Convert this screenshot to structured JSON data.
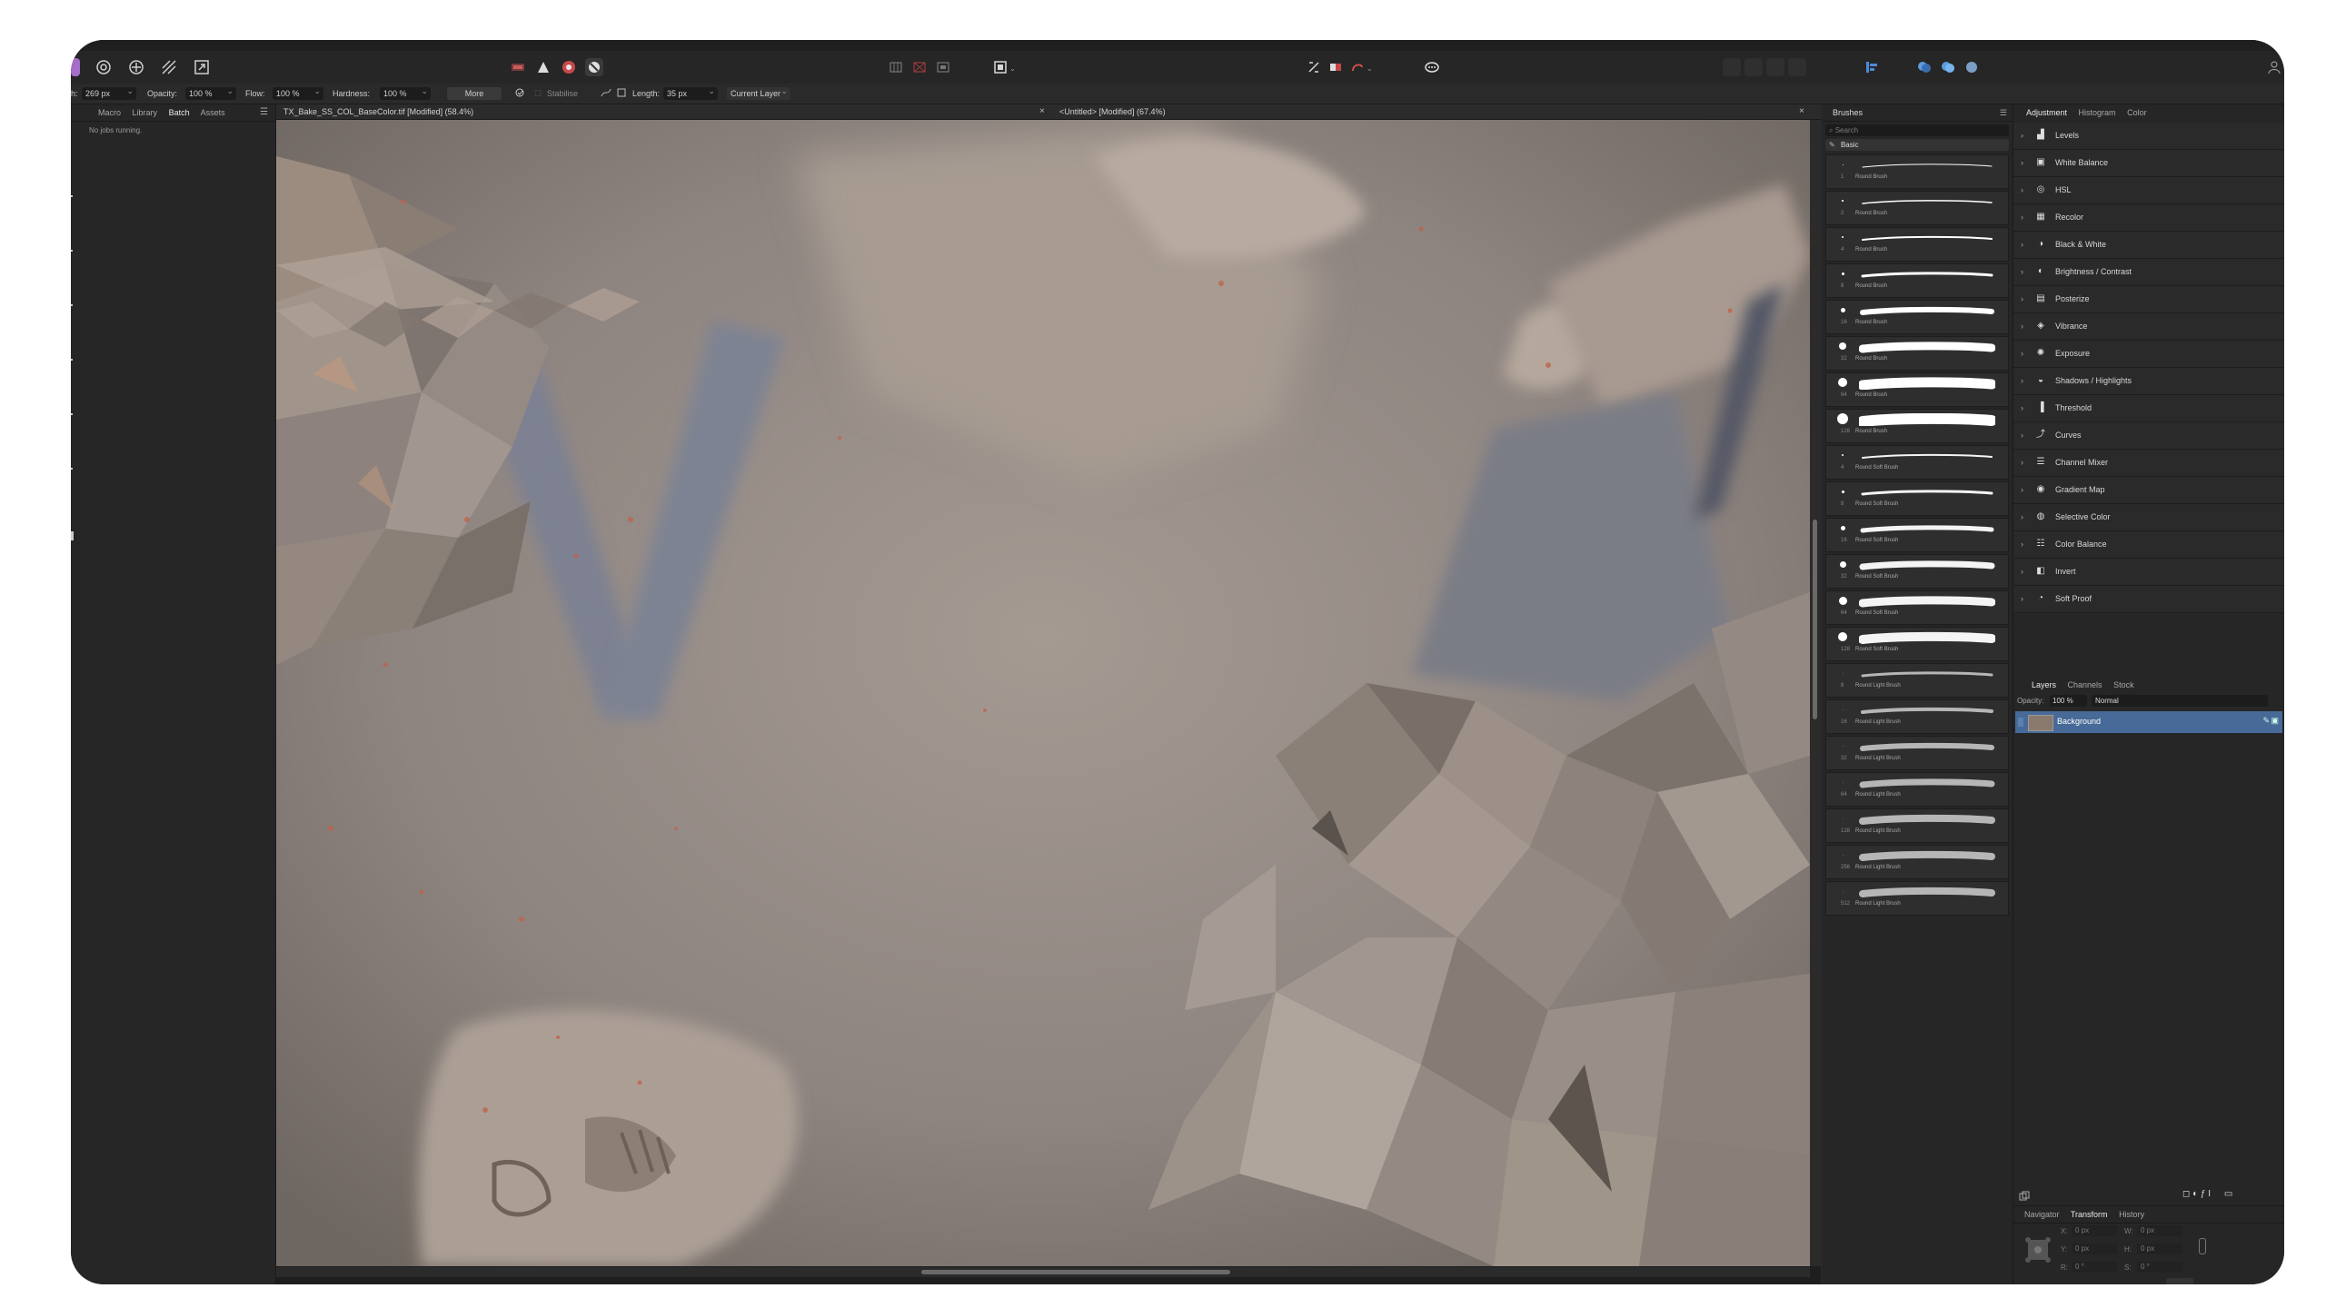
{
  "context_toolbar": {
    "width_value": "269 px",
    "opacity_label": "Opacity:",
    "opacity_value": "100 %",
    "flow_label": "Flow:",
    "flow_value": "100 %",
    "hardness_label": "Hardness:",
    "hardness_value": "100 %",
    "more_label": "More",
    "stabilise_label": "Stabilise",
    "length_label": "Length:",
    "length_value": "35 px",
    "target_value": "Current Layer"
  },
  "left_panel": {
    "tabs": [
      "Macro",
      "Library",
      "Batch",
      "Assets"
    ],
    "active_tab": "Batch",
    "status": "No jobs running."
  },
  "documents": {
    "tab1": "TX_Bake_SS_COL_BaseColor.tif [Modified] (58.4%)",
    "tab2": "<Untitled> [Modified] (67.4%)"
  },
  "brushes_panel": {
    "title": "Brushes",
    "search_placeholder": "Search",
    "category": "Basic",
    "items": [
      {
        "size": "1",
        "name": "Round Brush"
      },
      {
        "size": "2",
        "name": "Round Brush"
      },
      {
        "size": "4",
        "name": "Round Brush"
      },
      {
        "size": "8",
        "name": "Round Brush"
      },
      {
        "size": "16",
        "name": "Round Brush"
      },
      {
        "size": "32",
        "name": "Round Brush"
      },
      {
        "size": "64",
        "name": "Round Brush"
      },
      {
        "size": "128",
        "name": "Round Brush"
      },
      {
        "size": "4",
        "name": "Round Soft Brush"
      },
      {
        "size": "8",
        "name": "Round Soft Brush"
      },
      {
        "size": "16",
        "name": "Round Soft Brush"
      },
      {
        "size": "32",
        "name": "Round Soft Brush"
      },
      {
        "size": "64",
        "name": "Round Soft Brush"
      },
      {
        "size": "128",
        "name": "Round Soft Brush"
      },
      {
        "size": "8",
        "name": "Round Light Brush"
      },
      {
        "size": "16",
        "name": "Round Light Brush"
      },
      {
        "size": "32",
        "name": "Round Light Brush"
      },
      {
        "size": "64",
        "name": "Round Light Brush"
      },
      {
        "size": "128",
        "name": "Round Light Brush"
      },
      {
        "size": "256",
        "name": "Round Light Brush"
      },
      {
        "size": "512",
        "name": "Round Light Brush"
      }
    ]
  },
  "adjustment_panel": {
    "tabs": [
      "Adjustment",
      "Histogram",
      "Color"
    ],
    "items": [
      {
        "label": "Levels",
        "icon": "levels-icon"
      },
      {
        "label": "White Balance",
        "icon": "white-balance-icon"
      },
      {
        "label": "HSL",
        "icon": "hsl-icon"
      },
      {
        "label": "Recolor",
        "icon": "recolor-icon"
      },
      {
        "label": "Black & White",
        "icon": "black-white-icon"
      },
      {
        "label": "Brightness / Contrast",
        "icon": "brightness-icon"
      },
      {
        "label": "Posterize",
        "icon": "posterize-icon"
      },
      {
        "label": "Vibrance",
        "icon": "vibrance-icon"
      },
      {
        "label": "Exposure",
        "icon": "exposure-icon"
      },
      {
        "label": "Shadows / Highlights",
        "icon": "shadows-icon"
      },
      {
        "label": "Threshold",
        "icon": "threshold-icon"
      },
      {
        "label": "Curves",
        "icon": "curves-icon"
      },
      {
        "label": "Channel Mixer",
        "icon": "channel-mixer-icon"
      },
      {
        "label": "Gradient Map",
        "icon": "gradient-map-icon"
      },
      {
        "label": "Selective Color",
        "icon": "selective-color-icon"
      },
      {
        "label": "Color Balance",
        "icon": "color-balance-icon"
      },
      {
        "label": "Invert",
        "icon": "invert-icon"
      },
      {
        "label": "Soft Proof",
        "icon": "soft-proof-icon"
      }
    ]
  },
  "layers_panel": {
    "tabs": [
      "Layers",
      "Channels",
      "Stock"
    ],
    "opacity_label": "Opacity:",
    "opacity_value": "100 %",
    "blend_mode": "Normal",
    "layer_name": "Background"
  },
  "bottom_panel": {
    "tabs": [
      "Navigator",
      "Transform",
      "History"
    ],
    "x_label": "X:",
    "x_value": "0 px",
    "y_label": "Y:",
    "y_value": "0 px",
    "w_label": "W:",
    "w_value": "0 px",
    "h_label": "H:",
    "h_value": "0 px",
    "r_label": "R:",
    "r_value": "0 °",
    "s_label": "S:",
    "s_value": "0 °"
  },
  "colors": {
    "accent": "#476a98",
    "app_bg": "#2b2b2b",
    "persona_icon": "#a46ec9"
  }
}
